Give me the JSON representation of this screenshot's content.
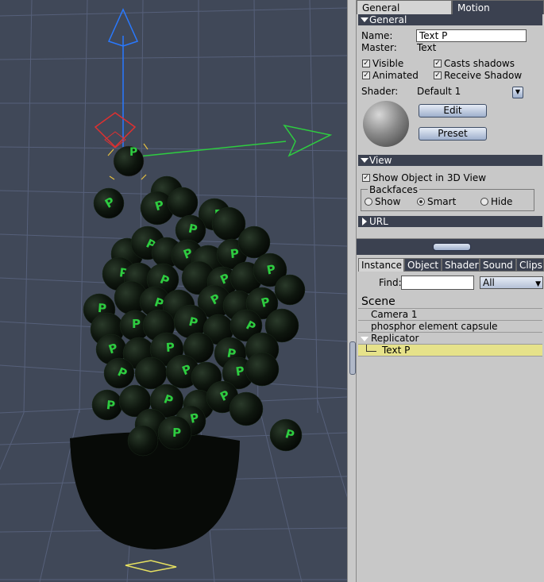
{
  "viewport": {
    "label": "3D View",
    "gizmo_letter": "P"
  },
  "tabs_top": [
    {
      "label": "General",
      "active": true
    },
    {
      "label": "Motion",
      "active": false
    }
  ],
  "general": {
    "header": "General",
    "name_label": "Name:",
    "name_value": "Text P",
    "master_label": "Master:",
    "master_value": "Text",
    "visible_label": "Visible",
    "visible_checked": true,
    "casts_shadows_label": "Casts shadows",
    "casts_shadows_checked": true,
    "animated_label": "Animated",
    "animated_checked": true,
    "receive_shadow_label": "Receive Shadow",
    "receive_shadow_checked": true,
    "shader_label": "Shader:",
    "shader_value": "Default 1",
    "edit_button": "Edit",
    "preset_button": "Preset"
  },
  "view": {
    "header": "View",
    "show_object_label": "Show Object in 3D View",
    "show_object_checked": true,
    "backfaces_label": "Backfaces",
    "options": [
      "Show",
      "Smart",
      "Hide"
    ],
    "selected": "Smart"
  },
  "url": {
    "header": "URL"
  },
  "tabs_bottom": [
    {
      "label": "Instance",
      "active": true
    },
    {
      "label": "Object",
      "active": false
    },
    {
      "label": "Shader",
      "active": false
    },
    {
      "label": "Sound",
      "active": false
    },
    {
      "label": "Clips",
      "active": false
    }
  ],
  "find": {
    "label": "Find:",
    "value": "",
    "filter": "All"
  },
  "tree": {
    "scene_label": "Scene",
    "items": [
      {
        "label": "Camera 1"
      },
      {
        "label": "phosphor element capsule"
      },
      {
        "label": "Replicator"
      },
      {
        "label": "Text P"
      }
    ]
  },
  "colors": {
    "viewport_bg": "#404858",
    "panel_bg": "#c8c8c8",
    "header_bg": "#3b4150",
    "selection": "#e6e28a",
    "gizmo_x": "#2ecc40",
    "gizmo_y": "#2979ff",
    "gizmo_rot": "#e03030"
  }
}
